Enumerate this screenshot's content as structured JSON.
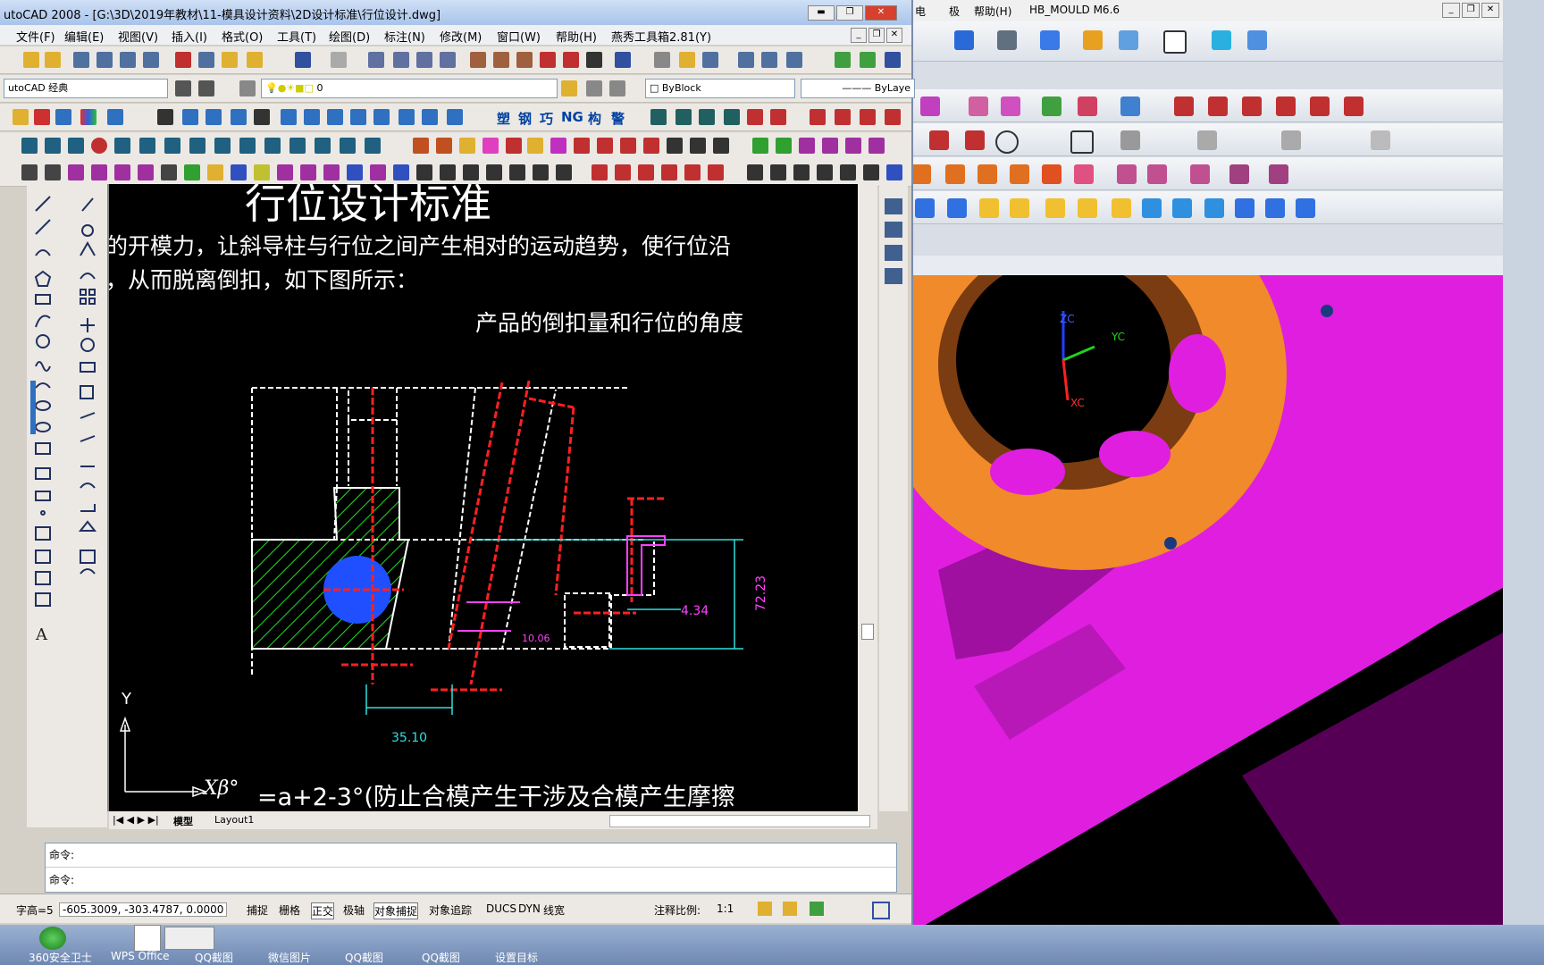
{
  "nx": {
    "menu": [
      "电",
      "极",
      "帮助(H)",
      "HB_MOULD M6.6"
    ],
    "axis_labels": [
      "ZC",
      "YC",
      "XC"
    ],
    "colors": {
      "part": "#f08a2a",
      "mold": "#e01ee0",
      "background": "#000000"
    }
  },
  "cad": {
    "title": "utoCAD 2008 - [G:\\3D\\2019年教材\\11-模具设计资料\\2D设计标准\\行位设计.dwg]",
    "menu": [
      "文件(F)",
      "编辑(E)",
      "视图(V)",
      "插入(I)",
      "格式(O)",
      "工具(T)",
      "绘图(D)",
      "标注(N)",
      "修改(M)",
      "窗口(W)",
      "帮助(H)",
      "燕秀工具箱2.81(Y)"
    ],
    "workspace": "utoCAD 经典",
    "layer": "0",
    "color_combo": "ByBlock",
    "linetype_combo": "ByLaye",
    "toolbar_text": [
      "塑",
      "钢",
      "巧",
      "NG",
      "构",
      "警"
    ],
    "drawing": {
      "heading": "行位设计标准",
      "line1": "的开模力，让斜导柱与行位之间产生相对的运动趋势，使行位沿",
      "line2": "，从而脱离倒扣，如下图所示：",
      "line3": "产品的倒扣量和行位的角度",
      "formula_sym": "Xβ°",
      "formula": "=a+2-3°(防止合模产生干涉及合模产生摩擦",
      "dim_1": "4.34",
      "dim_2": "72.23",
      "dim_3": "35.10",
      "dim_4": "10.06",
      "axis_y": "Y",
      "axis_x": "X"
    },
    "tabs": [
      "模型",
      "Layout1"
    ],
    "cmd_prompt_1": "命令:",
    "cmd_prompt_2": "命令:",
    "status_prefix": "字高=5",
    "coords": "-605.3009, -303.4787, 0.0000",
    "status_toggles": [
      "捕捉",
      "栅格",
      "正交",
      "极轴",
      "对象捕捉",
      "对象追踪",
      "DUCS",
      "DYN",
      "线宽"
    ],
    "annotation_scale_label": "注释比例:",
    "annotation_scale": "1:1"
  },
  "taskbar": [
    "360安全卫士",
    "WPS Office",
    "QQ截图",
    "微信图片",
    "QQ截图",
    "QQ截图",
    "设置目标"
  ]
}
